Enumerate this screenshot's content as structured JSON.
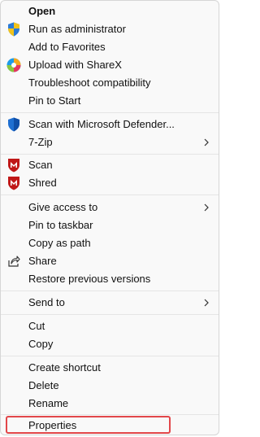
{
  "menu": {
    "items": {
      "open": "Open",
      "run_as_admin": "Run as administrator",
      "add_favorites": "Add to Favorites",
      "upload_sharex": "Upload with ShareX",
      "troubleshoot": "Troubleshoot compatibility",
      "pin_start": "Pin to Start",
      "scan_defender": "Scan with Microsoft Defender...",
      "seven_zip": "7-Zip",
      "scan": "Scan",
      "shred": "Shred",
      "give_access": "Give access to",
      "pin_taskbar": "Pin to taskbar",
      "copy_path": "Copy as path",
      "share": "Share",
      "restore_versions": "Restore previous versions",
      "send_to": "Send to",
      "cut": "Cut",
      "copy": "Copy",
      "create_shortcut": "Create shortcut",
      "delete": "Delete",
      "rename": "Rename",
      "properties": "Properties"
    },
    "icons": {
      "run_as_admin": "uac-shield-icon",
      "upload_sharex": "sharex-icon",
      "scan_defender": "defender-shield-icon",
      "scan": "mcafee-icon",
      "shred": "mcafee-icon",
      "share": "share-icon"
    },
    "highlight_color": "#e2474a"
  }
}
